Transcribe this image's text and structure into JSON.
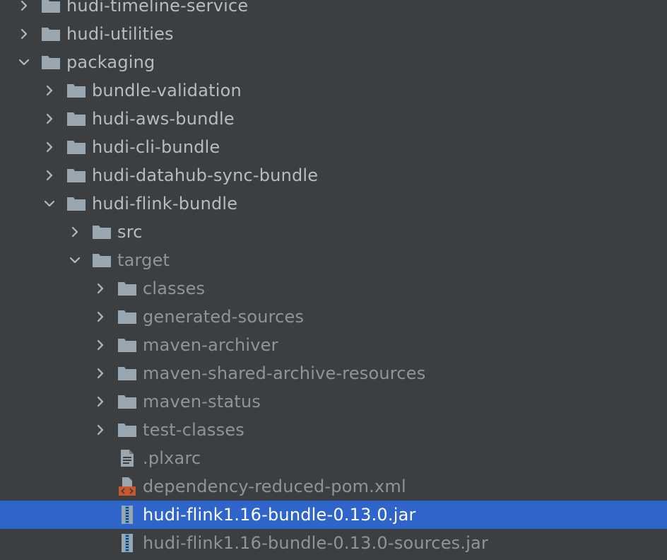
{
  "colors": {
    "background": "#3c3f41",
    "selection": "#2f65ca",
    "text_normal": "#bbbbbb",
    "text_excluded": "#8f9498",
    "folder_icon": "#9aa7b0",
    "xml_icon_accent": "#c9572c",
    "jar_icon_accent": "#5a9fd4"
  },
  "tree": {
    "items": [
      {
        "label": "hudi-timeline-service",
        "depth": 0,
        "expanded": false,
        "has_children": true,
        "kind": "folder",
        "excluded": false,
        "selected": false
      },
      {
        "label": "hudi-utilities",
        "depth": 0,
        "expanded": false,
        "has_children": true,
        "kind": "folder",
        "excluded": false,
        "selected": false
      },
      {
        "label": "packaging",
        "depth": 0,
        "expanded": true,
        "has_children": true,
        "kind": "folder",
        "excluded": false,
        "selected": false
      },
      {
        "label": "bundle-validation",
        "depth": 1,
        "expanded": false,
        "has_children": true,
        "kind": "folder",
        "excluded": false,
        "selected": false
      },
      {
        "label": "hudi-aws-bundle",
        "depth": 1,
        "expanded": false,
        "has_children": true,
        "kind": "folder",
        "excluded": false,
        "selected": false
      },
      {
        "label": "hudi-cli-bundle",
        "depth": 1,
        "expanded": false,
        "has_children": true,
        "kind": "folder",
        "excluded": false,
        "selected": false
      },
      {
        "label": "hudi-datahub-sync-bundle",
        "depth": 1,
        "expanded": false,
        "has_children": true,
        "kind": "folder",
        "excluded": false,
        "selected": false
      },
      {
        "label": "hudi-flink-bundle",
        "depth": 1,
        "expanded": true,
        "has_children": true,
        "kind": "folder",
        "excluded": false,
        "selected": false
      },
      {
        "label": "src",
        "depth": 2,
        "expanded": false,
        "has_children": true,
        "kind": "folder",
        "excluded": false,
        "selected": false
      },
      {
        "label": "target",
        "depth": 2,
        "expanded": true,
        "has_children": true,
        "kind": "folder",
        "excluded": true,
        "selected": false
      },
      {
        "label": "classes",
        "depth": 3,
        "expanded": false,
        "has_children": true,
        "kind": "folder",
        "excluded": true,
        "selected": false
      },
      {
        "label": "generated-sources",
        "depth": 3,
        "expanded": false,
        "has_children": true,
        "kind": "folder",
        "excluded": true,
        "selected": false
      },
      {
        "label": "maven-archiver",
        "depth": 3,
        "expanded": false,
        "has_children": true,
        "kind": "folder",
        "excluded": true,
        "selected": false
      },
      {
        "label": "maven-shared-archive-resources",
        "depth": 3,
        "expanded": false,
        "has_children": true,
        "kind": "folder",
        "excluded": true,
        "selected": false
      },
      {
        "label": "maven-status",
        "depth": 3,
        "expanded": false,
        "has_children": true,
        "kind": "folder",
        "excluded": true,
        "selected": false
      },
      {
        "label": "test-classes",
        "depth": 3,
        "expanded": false,
        "has_children": true,
        "kind": "folder",
        "excluded": true,
        "selected": false
      },
      {
        "label": ".plxarc",
        "depth": 3,
        "expanded": false,
        "has_children": false,
        "kind": "text-file",
        "excluded": true,
        "selected": false
      },
      {
        "label": "dependency-reduced-pom.xml",
        "depth": 3,
        "expanded": false,
        "has_children": false,
        "kind": "xml-file",
        "excluded": true,
        "selected": false
      },
      {
        "label": "hudi-flink1.16-bundle-0.13.0.jar",
        "depth": 3,
        "expanded": false,
        "has_children": false,
        "kind": "jar-file",
        "excluded": true,
        "selected": true
      },
      {
        "label": "hudi-flink1.16-bundle-0.13.0-sources.jar",
        "depth": 3,
        "expanded": false,
        "has_children": false,
        "kind": "jar-file",
        "excluded": true,
        "selected": false
      }
    ]
  }
}
